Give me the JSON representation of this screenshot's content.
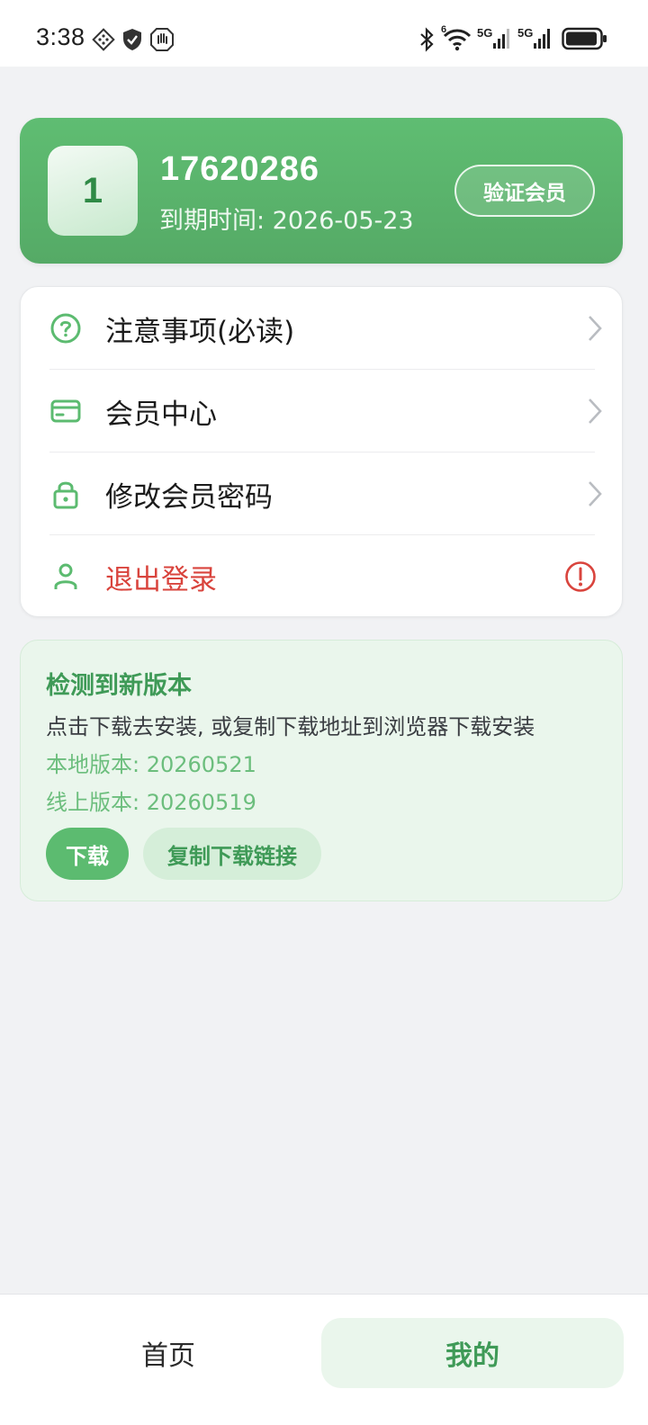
{
  "status_bar": {
    "time": "3:38",
    "left_icons": [
      "diamond-grid-icon",
      "shield-icon",
      "hand-icon"
    ],
    "right_icons": [
      "bluetooth-icon",
      "wifi-icon",
      "signal-5g-icon",
      "signal-5g-icon",
      "battery-icon"
    ],
    "wifi_badge": "6",
    "network_label_1": "5G",
    "network_label_2": "5G"
  },
  "profile": {
    "avatar_text": "1",
    "user_id": "17620286",
    "expire_text": "到期时间: 2026-05-23",
    "verify_label": "验证会员"
  },
  "menu": {
    "items": [
      {
        "icon": "question-circle-icon",
        "label": "注意事项(必读)",
        "trailing": "chevron-right-icon"
      },
      {
        "icon": "card-icon",
        "label": "会员中心",
        "trailing": "chevron-right-icon"
      },
      {
        "icon": "lock-icon",
        "label": "修改会员密码",
        "trailing": "chevron-right-icon"
      },
      {
        "icon": "user-icon",
        "label": "退出登录",
        "trailing": "alert-circle-icon"
      }
    ]
  },
  "update": {
    "title": "检测到新版本",
    "description": "点击下载去安装, 或复制下载地址到浏览器下载安装",
    "local_version": "本地版本: 20260521",
    "online_version": "线上版本: 20260519",
    "download_label": "下载",
    "copy_label": "复制下载链接"
  },
  "tabbar": {
    "tabs": [
      {
        "label": "首页",
        "active": false
      },
      {
        "label": "我的",
        "active": true
      }
    ]
  },
  "colors": {
    "accent": "#5cbb70",
    "accent_dark": "#3f9a57",
    "danger": "#d9443d",
    "background": "#f1f2f4"
  }
}
